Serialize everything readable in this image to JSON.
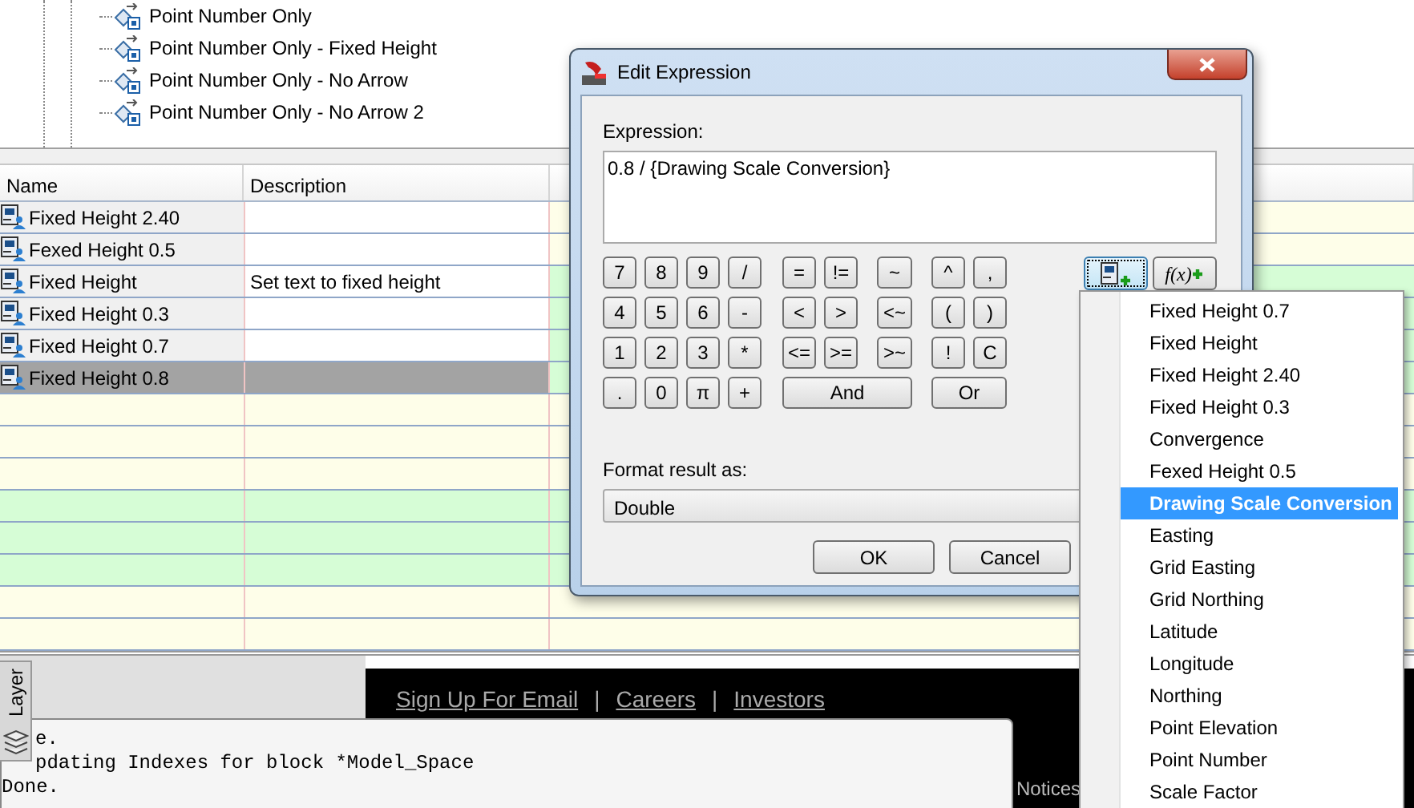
{
  "tree": {
    "items": [
      {
        "label": "Point Number Only"
      },
      {
        "label": "Point Number Only - Fixed Height"
      },
      {
        "label": "Point Number Only - No Arrow"
      },
      {
        "label": "Point Number Only - No Arrow 2"
      }
    ]
  },
  "table": {
    "columns": [
      "Name",
      "Description"
    ],
    "rows": [
      {
        "name": "Fixed Height 2.40",
        "selected": false,
        "color": "#fefee9"
      },
      {
        "name": "Fexed Height 0.5",
        "selected": false,
        "color": "#fefee9"
      },
      {
        "name": "Fixed Height",
        "description": "Set text to fixed height",
        "selected": false,
        "color": "#d6fdd6"
      },
      {
        "name": "Fixed Height 0.3",
        "selected": false,
        "color": "#d6fdd6"
      },
      {
        "name": "Fixed Height 0.7",
        "selected": false,
        "color": "#d6fdd6"
      },
      {
        "name": "Fixed Height 0.8",
        "selected": true,
        "color": "#d6fdd6"
      },
      {
        "selected": false,
        "color": "#fefee9"
      },
      {
        "selected": false,
        "color": "#fefee9"
      },
      {
        "selected": false,
        "color": "#fefee9"
      },
      {
        "selected": false,
        "color": "#d6fdd6"
      },
      {
        "selected": false,
        "color": "#d6fdd6"
      },
      {
        "selected": false,
        "color": "#d6fdd6"
      },
      {
        "selected": false,
        "color": "#fefee9"
      },
      {
        "selected": false,
        "color": "#fefee9"
      }
    ]
  },
  "dialog": {
    "title": "Edit Expression",
    "expression_label": "Expression:",
    "expression": "0.8 / {Drawing Scale Conversion}",
    "keypad": [
      [
        {
          "label": "7",
          "kind": "key"
        },
        {
          "label": "8",
          "kind": "key"
        },
        {
          "label": "9",
          "kind": "key"
        },
        {
          "label": "/",
          "kind": "key"
        },
        {
          "label": "=",
          "kind": "key"
        },
        {
          "label": "!=",
          "kind": "key"
        },
        {
          "label": "~",
          "kind": "key"
        },
        {
          "label": "^",
          "kind": "key"
        },
        {
          "label": ",",
          "kind": "key"
        }
      ],
      [
        {
          "label": "4",
          "kind": "key"
        },
        {
          "label": "5",
          "kind": "key"
        },
        {
          "label": "6",
          "kind": "key"
        },
        {
          "label": "-",
          "kind": "key"
        },
        {
          "label": "<",
          "kind": "key"
        },
        {
          "label": ">",
          "kind": "key"
        },
        {
          "label": "<~",
          "kind": "key"
        },
        {
          "label": "(",
          "kind": "key"
        },
        {
          "label": ")",
          "kind": "key"
        }
      ],
      [
        {
          "label": "1",
          "kind": "key"
        },
        {
          "label": "2",
          "kind": "key"
        },
        {
          "label": "3",
          "kind": "key"
        },
        {
          "label": "*",
          "kind": "key"
        },
        {
          "label": "<=",
          "kind": "key"
        },
        {
          "label": ">=",
          "kind": "key"
        },
        {
          "label": ">~",
          "kind": "key"
        },
        {
          "label": "!",
          "kind": "key"
        },
        {
          "label": "C",
          "kind": "key"
        }
      ],
      [
        {
          "label": ".",
          "kind": "key"
        },
        {
          "label": "0",
          "kind": "key"
        },
        {
          "label": "π",
          "kind": "key"
        },
        {
          "label": "+",
          "kind": "key"
        },
        {
          "label": "And",
          "kind": "wide"
        },
        {
          "label": "Or",
          "kind": "wide"
        }
      ]
    ],
    "insert_buttons": [
      {
        "kind": "field",
        "focused": true
      },
      {
        "kind": "function",
        "label": "f(x)",
        "focused": false
      }
    ],
    "format_label": "Format result as:",
    "format_value": "Double",
    "buttons": [
      "OK",
      "Cancel"
    ]
  },
  "field_menu": {
    "items": [
      {
        "label": "Fixed Height 0.7",
        "selected": false
      },
      {
        "label": "Fixed Height",
        "selected": false
      },
      {
        "label": "Fixed Height 2.40",
        "selected": false
      },
      {
        "label": "Fixed Height 0.3",
        "selected": false
      },
      {
        "label": "Convergence",
        "selected": false
      },
      {
        "label": "Fexed Height 0.5",
        "selected": false
      },
      {
        "label": "Drawing Scale Conversion",
        "selected": true
      },
      {
        "label": "Easting",
        "selected": false
      },
      {
        "label": "Grid Easting",
        "selected": false
      },
      {
        "label": "Grid Northing",
        "selected": false
      },
      {
        "label": "Latitude",
        "selected": false
      },
      {
        "label": "Longitude",
        "selected": false
      },
      {
        "label": "Northing",
        "selected": false
      },
      {
        "label": "Point Elevation",
        "selected": false
      },
      {
        "label": "Point Number",
        "selected": false
      },
      {
        "label": "Scale Factor",
        "selected": false
      }
    ]
  },
  "bottom": {
    "layer_tab": "Layer",
    "links": [
      "Sign Up For Email",
      "|",
      "Careers",
      "|",
      "Investors"
    ],
    "notice": "Notices",
    "command_lines": [
      "e.",
      "pdating Indexes for block *Model_Space",
      "Done."
    ]
  }
}
